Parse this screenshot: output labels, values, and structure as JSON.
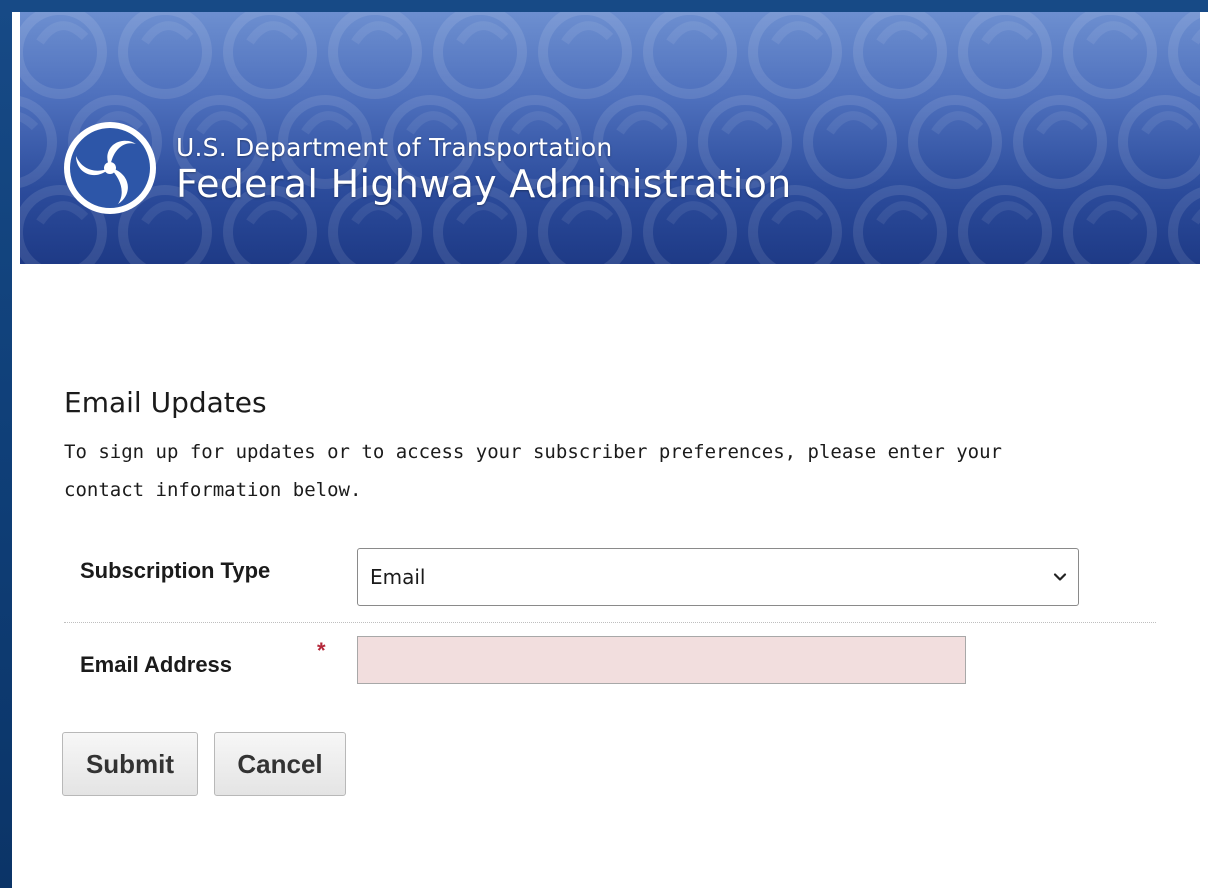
{
  "header": {
    "department": "U.S. Department of Transportation",
    "agency": "Federal Highway Administration",
    "logo_icon": "dot-triskelion-logo",
    "banner_color": "#2f4f9f"
  },
  "form": {
    "title": "Email Updates",
    "intro": "To sign up for updates or to access your subscriber preferences, please enter your contact information below.",
    "subscription_type": {
      "label": "Subscription Type",
      "selected": "Email"
    },
    "email": {
      "label": "Email Address",
      "required_marker": "*",
      "value": "",
      "invalid_background": "#f2dede"
    },
    "buttons": {
      "submit": "Submit",
      "cancel": "Cancel"
    }
  }
}
